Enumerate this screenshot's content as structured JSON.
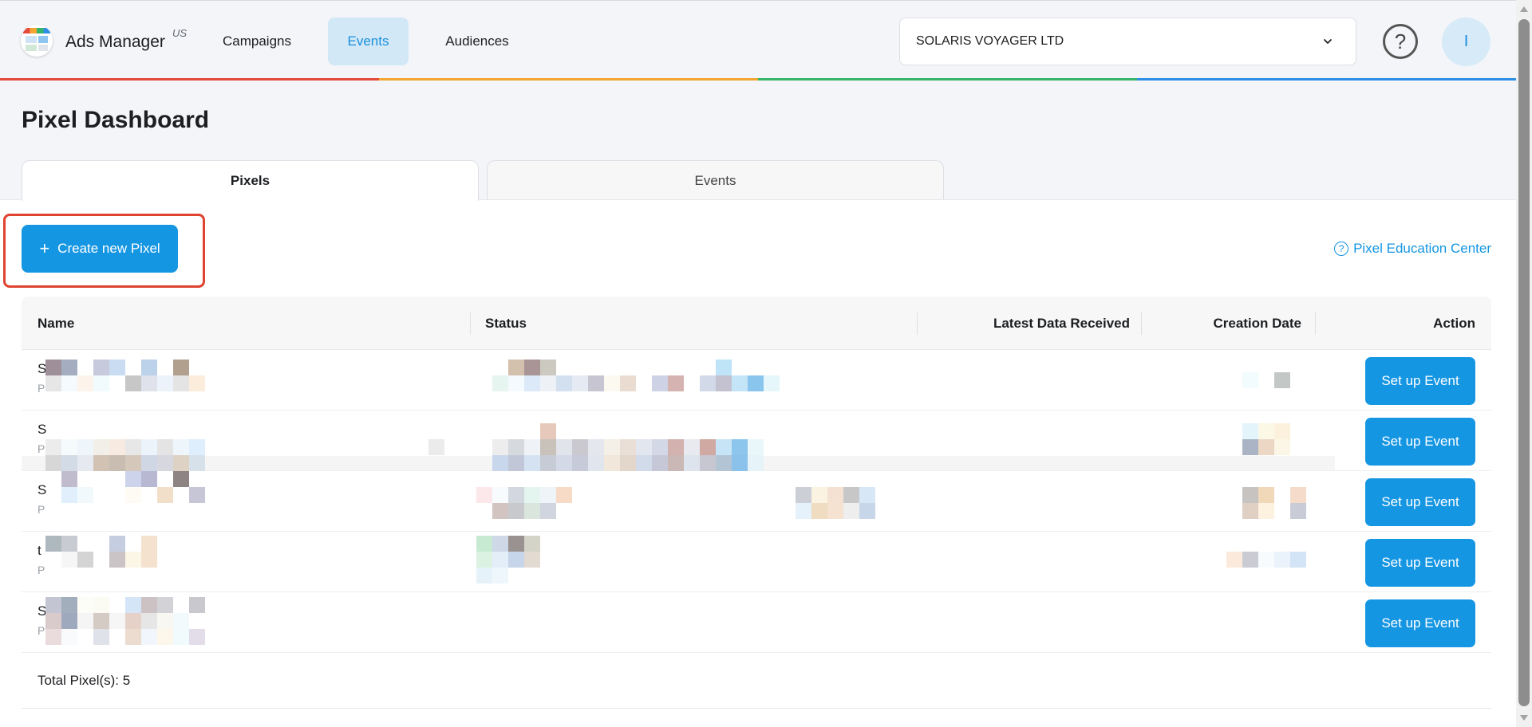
{
  "header": {
    "app_title": "Ads Manager",
    "region": "US",
    "nav": [
      {
        "label": "Campaigns",
        "active": false
      },
      {
        "label": "Events",
        "active": true
      },
      {
        "label": "Audiences",
        "active": false
      }
    ],
    "account": "SOLARIS VOYAGER LTD",
    "help_icon": "question-circle-icon",
    "avatar_initial": "I"
  },
  "page": {
    "title": "Pixel Dashboard",
    "tabs": [
      {
        "label": "Pixels",
        "active": true
      },
      {
        "label": "Events",
        "active": false
      }
    ],
    "create_button": "Create new Pixel",
    "education_link": "Pixel Education Center"
  },
  "table": {
    "columns": [
      "Name",
      "Status",
      "Latest Data Received",
      "Creation Date",
      "Action"
    ],
    "rows": [
      {
        "name_initial": "S",
        "sub_initial": "P",
        "action": "Set up Event"
      },
      {
        "name_initial": "S",
        "sub_initial": "P",
        "action": "Set up Event"
      },
      {
        "name_initial": "S",
        "sub_initial": "P",
        "action": "Set up Event"
      },
      {
        "name_initial": "t",
        "sub_initial": "P",
        "action": "Set up Event"
      },
      {
        "name_initial": "S",
        "sub_initial": "P",
        "action": "Set up Event"
      }
    ],
    "total_label": "Total Pixel(s): 5"
  },
  "colors": {
    "accent": "#1596e3",
    "nav_active_bg": "#d2e8f7",
    "highlight_border": "#e0432f",
    "rainbow": [
      "#e64a3b",
      "#f3a531",
      "#35b46a",
      "#2d8ee6"
    ]
  }
}
